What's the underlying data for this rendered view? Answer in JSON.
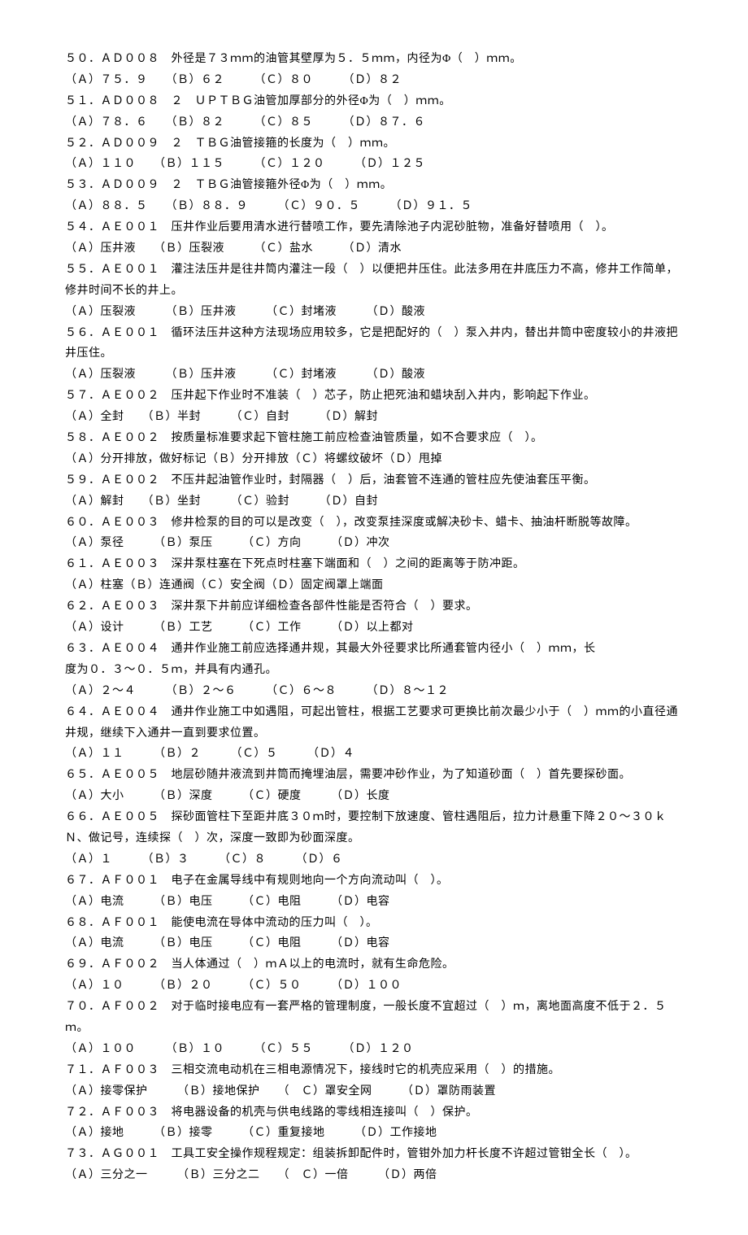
{
  "questions": [
    {
      "q": "５０．ＡＤ００８　外径是７３ｍｍ的油管其壁厚为５．５ｍｍ，内径为Φ（　）ｍｍ。",
      "opts": "（Ａ）７５．９　　（Ｂ）６２　　　（Ｃ）８０　　　（Ｄ）８２"
    },
    {
      "q": "５１．ＡＤ００８　２　ＵＰＴＢＧ油管加厚部分的外径Φ为（　）ｍｍ。",
      "opts": "（Ａ）７８．６　　（Ｂ）８２　　　（Ｃ）８５　　　（Ｄ）８７．６"
    },
    {
      "q": "５２．ＡＤ００９　２　ＴＢＧ油管接箍的长度为（　）ｍｍ。",
      "opts": "（Ａ）１１０　　（Ｂ）１１５　　　（Ｃ）１２０　　　（Ｄ）１２５"
    },
    {
      "q": "５３．ＡＤ００９　２　ＴＢＧ油管接箍外径Φ为（　）ｍｍ。",
      "opts": "（Ａ）８８．５　　（Ｂ）８８．９　　　（Ｃ）９０．５　　　（Ｄ）９１．５"
    },
    {
      "q": "５４．ＡＥ００１　压井作业后要用清水进行替喷工作，要先清除池子内泥砂脏物，准备好替喷用（　）。",
      "opts": "（Ａ）压井液　　（Ｂ）压裂液　　　（Ｃ）盐水　　　（Ｄ）清水"
    },
    {
      "q": "５５．ＡＥ００１　灌注法压井是往井筒内灌注一段（　）以便把井压住。此法多用在井底压力不高，修井工作简单，修井时间不长的井上。",
      "opts": "（Ａ）压裂液　　　（Ｂ）压井液　　　（Ｃ）封堵液　　　（Ｄ）酸液"
    },
    {
      "q": "５６．ＡＥ００１　循环法压井这种方法现场应用较多，它是把配好的（　）泵入井内，替出井筒中密度较小的井液把井压住。",
      "opts": "（Ａ）压裂液　　　（Ｂ）压井液　　　（Ｃ）封堵液　　　（Ｄ）酸液"
    },
    {
      "q": "５７．ＡＥ００２　压井起下作业时不准装（　）芯子，防止把死油和蜡块刮入井内，影响起下作业。",
      "opts": "（Ａ）全封　　（Ｂ）半封　　　（Ｃ）自封　　　（Ｄ）解封"
    },
    {
      "q": "５８．ＡＥ００２　按质量标准要求起下管柱施工前应检查油管质量，如不合要求应（　）。",
      "opts": "（Ａ）分开排放，做好标记（Ｂ）分开排放（Ｃ）将螺纹破坏（Ｄ）甩掉"
    },
    {
      "q": "５９．ＡＥ００２　不压井起油管作业时，封隔器（　）后，油套管不连通的管柱应先使油套压平衡。",
      "opts": "（Ａ）解封　　（Ｂ）坐封　　　（Ｃ）验封　　　（Ｄ）自封"
    },
    {
      "q": "６０．ＡＥ００３　修井检泵的目的可以是改变（　），改变泵挂深度或解决砂卡、蜡卡、抽油杆断脱等故障。",
      "opts": "（Ａ）泵径　　　（Ｂ）泵压　　　（Ｃ）方向　　　（Ｄ）冲次"
    },
    {
      "q": "６１．ＡＥ００３　深井泵柱塞在下死点时柱塞下端面和（　）之间的距离等于防冲距。",
      "opts": "（Ａ）柱塞（Ｂ）连通阀（Ｃ）安全阀（Ｄ）固定阀罩上端面"
    },
    {
      "q": "６２．ＡＥ００３　深井泵下井前应详细检查各部件性能是否符合（　）要求。",
      "opts": "（Ａ）设计　　　（Ｂ）工艺　　　（Ｃ）工作　　　（Ｄ）以上都对"
    },
    {
      "q": "６３．ＡＥ００４　通井作业施工前应选择通井规，其最大外径要求比所通套管内径小（　）ｍｍ，长",
      "q2": "度为０．３～０．５ｍ，并具有内通孔。",
      "opts": "（Ａ）２～４　　　（Ｂ）２～６　　　（Ｃ）６～８　　　（Ｄ）８～１２"
    },
    {
      "q": "６４．ＡＥ００４　通井作业施工中如遇阻，可起出管柱，根据工艺要求可更换比前次最少小于（　）ｍｍ的小直径通井规，继续下入通井一直到要求位置。",
      "opts": "（Ａ）１１　　　（Ｂ）２　　　（Ｃ）５　　　（Ｄ）４"
    },
    {
      "q": "６５．ＡＥ００５　地层砂随井液流到井筒而掩埋油层，需要冲砂作业，为了知道砂面（　）首先要探砂面。",
      "opts": "（Ａ）大小　　　（Ｂ）深度　　　（Ｃ）硬度　　　（Ｄ）长度"
    },
    {
      "q": "６６．ＡＥ００５　探砂面管柱下至距井底３０ｍ时，要控制下放速度、管柱遇阻后，拉力计悬重下降２０～３０ｋＮ、做记号，连续探（　）次，深度一致即为砂面深度。",
      "opts": "（Ａ）１　　　（Ｂ）３　　　（Ｃ）８　　　（Ｄ）６"
    },
    {
      "q": "６７．ＡＦ００１　电子在金属导线中有规则地向一个方向流动叫（　）。",
      "opts": "（Ａ）电流　　　（Ｂ）电压　　　（Ｃ）电阻　　　（Ｄ）电容"
    },
    {
      "q": "６８．ＡＦ００１　能使电流在导体中流动的压力叫（　）。",
      "opts": "（Ａ）电流　　　（Ｂ）电压　　　（Ｃ）电阻　　　（Ｄ）电容"
    },
    {
      "q": "６９．ＡＦ００２　当人体通过（　）ｍＡ以上的电流时，就有生命危险。",
      "opts": "（Ａ）１０　　　（Ｂ）２０　　　（Ｃ）５０　　　（Ｄ）１００"
    },
    {
      "q": "７０．ＡＦ００２　对于临时接电应有一套严格的管理制度，一般长度不宜超过（　）ｍ，离地面高度不低于２．５ｍ。",
      "opts": "（Ａ）１００　　　（Ｂ）１０　　　（Ｃ）５５　　　（Ｄ）１２０"
    },
    {
      "q": "７１．ＡＦ００３　三相交流电动机在三相电源情况下，接线时它的机壳应采用（　）的措施。",
      "opts": "（Ａ）接零保护　　　（Ｂ）接地保护　　（　Ｃ）罩安全网　　　（Ｄ）罩防雨装置"
    },
    {
      "q": "７２．ＡＦ００３　将电器设备的机壳与供电线路的零线相连接叫（　）保护。",
      "opts": "（Ａ）接地　　　（Ｂ）接零　　　（Ｃ）重复接地　　　（Ｄ）工作接地"
    },
    {
      "q": "７３．ＡＧ００１　工具工安全操作规程规定：组装拆卸配件时，管钳外加力杆长度不许超过管钳全长（　）。",
      "opts": "（Ａ）三分之一　　　（Ｂ）三分之二　　（　Ｃ）一倍　　　（Ｄ）两倍"
    }
  ]
}
